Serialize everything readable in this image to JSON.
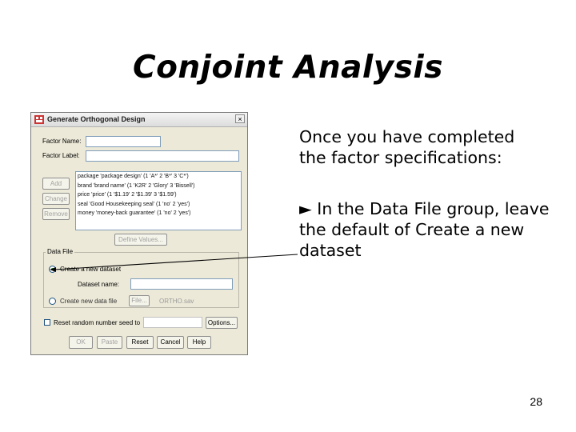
{
  "slide": {
    "title": "Conjoint Analysis",
    "paragraph1": "Once you have completed the factor specifications:",
    "paragraph2_bullet": "►",
    "paragraph2": "In the Data File group, leave the default of Create a new dataset",
    "page_number": "28"
  },
  "dialog": {
    "title": "Generate Orthogonal Design",
    "close_glyph": "×",
    "factor_name_label": "Factor Name:",
    "factor_label_label": "Factor Label:",
    "factor_name_value": "",
    "factor_label_value": "",
    "buttons": {
      "add": "Add",
      "change": "Change",
      "remove": "Remove",
      "define_values": "Define Values...",
      "file": "File...",
      "options": "Options...",
      "ok": "OK",
      "paste": "Paste",
      "reset": "Reset",
      "cancel": "Cancel",
      "help": "Help"
    },
    "factors": [
      "package 'package design' (1 'A*' 2 'B*' 3 'C*')",
      "brand 'brand name' (1 'K2R' 2 'Glory' 3 'Bissell')",
      "price 'price' (1 '$1.19' 2 '$1.39' 3 '$1.59')",
      "seal 'Good Housekeeping seal' (1 'no' 2 'yes')",
      "money 'money-back guarantee' (1 'no' 2 'yes')"
    ],
    "data_file": {
      "group_label": "Data File",
      "create_dataset_label": "Create a new dataset",
      "dataset_name_label": "Dataset name:",
      "dataset_name_value": "",
      "create_file_label": "Create new data file",
      "file_path": "ORTHO.sav",
      "selected_option": "Create a new dataset"
    },
    "reset_seed_label": "Reset random number seed to",
    "seed_value": ""
  },
  "colors": {
    "radio_selected": "#21a121",
    "field_border": "#7f9db9",
    "dialog_bg": "#ece9d8"
  }
}
